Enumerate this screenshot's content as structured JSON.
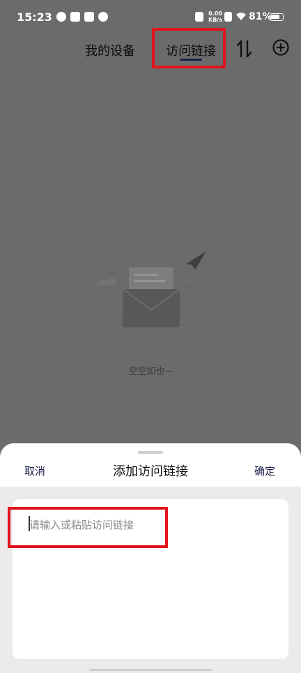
{
  "status_bar": {
    "time": "15:23",
    "net_speed_value": "0.00",
    "net_speed_unit": "KB/s",
    "battery": "81%",
    "battery_level": 0.81
  },
  "nav": {
    "tabs": [
      {
        "label": "我的设备",
        "active": false
      },
      {
        "label": "访问链接",
        "active": true
      }
    ],
    "icons": [
      "sort-arrows-icon",
      "add-circle-icon"
    ]
  },
  "empty_state": {
    "text": "空空如也~",
    "illustration": "envelope-paper-plane-icon"
  },
  "sheet": {
    "cancel": "取消",
    "title": "添加访问链接",
    "confirm": "确定",
    "input_placeholder": "请输入或粘贴访问链接",
    "input_value": ""
  },
  "colors": {
    "overlay": "#6b6b6b",
    "accent": "#1a1e4a",
    "highlight": "#e0141e"
  }
}
